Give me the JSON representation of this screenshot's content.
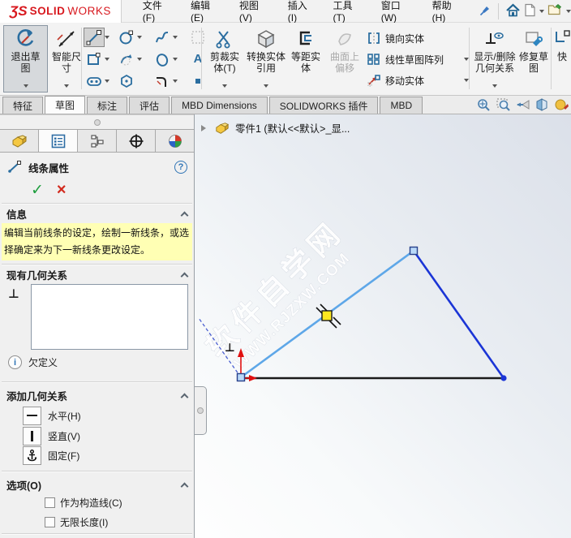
{
  "window": {
    "logo_mark": "ƷS",
    "logo_solid": "SOLID",
    "logo_works": "WORKS"
  },
  "menubar": {
    "items": [
      "文件(F)",
      "编辑(E)",
      "视图(V)",
      "插入(I)",
      "工具(T)",
      "窗口(W)",
      "帮助(H)"
    ]
  },
  "ribbon": {
    "exit_sketch": "退出草图",
    "smart_dimension": "智能尺寸",
    "trim": "剪裁实体(T)",
    "convert": "转换实体引用",
    "offset": "等距实体",
    "surface_offset": "曲面上偏移",
    "mirror": "镜向实体",
    "linear_pattern": "线性草图阵列",
    "move": "移动实体",
    "display_delete_relations": "显示/删除几何关系",
    "repair_sketch": "修复草图",
    "quick_snaps_partial": "快"
  },
  "tabs": {
    "items": [
      "特征",
      "草图",
      "标注",
      "评估",
      "MBD Dimensions",
      "SOLIDWORKS 插件",
      "MBD"
    ],
    "active": "草图"
  },
  "panel": {
    "title": "线条属性",
    "info": {
      "label": "信息",
      "message": "编辑当前线条的设定，绘制一新线条，或选择确定来为下一新线条更改设定。"
    },
    "existing_relations": {
      "label": "现有几何关系",
      "status": "欠定义"
    },
    "add_relations": {
      "label": "添加几何关系",
      "buttons": [
        "水平(H)",
        "竖直(V)",
        "固定(F)"
      ]
    },
    "options": {
      "label": "选项(O)",
      "checkboxes": [
        "作为构造线(C)",
        "无限长度(I)"
      ]
    }
  },
  "graphics": {
    "tree_label": "零件1 (默认<<默认>_显...",
    "watermark_cn": "软件自学网",
    "watermark_url": "WWW.RJZXW.COM"
  },
  "icons": {
    "question": "?",
    "info": "i",
    "check": "✓",
    "cross": "×",
    "perpendicular": "⊥",
    "perpendicular_badge": "⊥",
    "text_tool": "A"
  },
  "colors": {
    "logo_red": "#d8191f",
    "sketch_line_light_blue": "#5ea7e8",
    "sketch_line_dark_blue": "#1b35d6",
    "sketch_line_black": "#1a1a1a",
    "snap_yellow": "#ffe81f",
    "message_yellow": "#ffffb4",
    "origin_red": "#e01010"
  }
}
